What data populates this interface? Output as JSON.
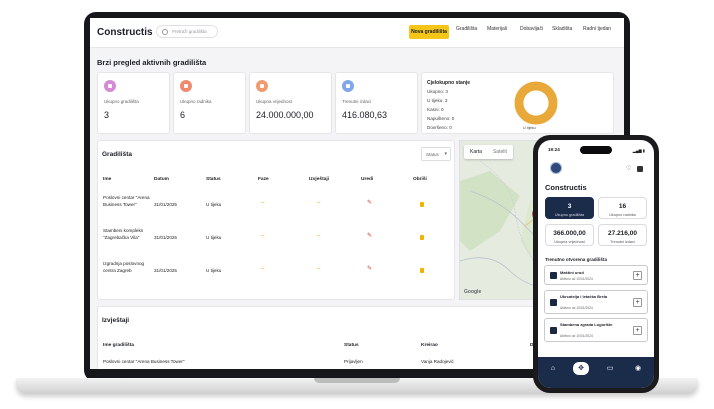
{
  "app": {
    "title": "Constructis",
    "search_placeholder": "Pretraži gradilišta"
  },
  "nav": {
    "items": [
      {
        "label": "Nova gradilišta",
        "active": true
      },
      {
        "label": "Gradilišta"
      },
      {
        "label": "Materijali"
      },
      {
        "label": "Dobavljači"
      },
      {
        "label": "Skladišta"
      },
      {
        "label": "Radni tjedan"
      }
    ]
  },
  "overview": {
    "title": "Brzi pregled aktivnih gradilišta",
    "stats": [
      {
        "label": "Ukupno gradilišta",
        "value": "3",
        "icon": "building-icon",
        "color": "#d68ad6"
      },
      {
        "label": "Ukupno radnika",
        "value": "6",
        "icon": "worker-icon",
        "color": "#f08a6e"
      },
      {
        "label": "Ukupna vrijednost",
        "value": "24.000.000,00",
        "icon": "money-icon",
        "color": "#f29a6f"
      },
      {
        "label": "Trenutni izdaci",
        "value": "416.080,63",
        "icon": "expense-icon",
        "color": "#7fa7ea"
      }
    ],
    "status_card": {
      "title": "Cjelokupno stanje",
      "lines": [
        "Ukupno: 3",
        "U tijeku: 3",
        "Kasni: 0",
        "Napušteno: 0",
        "Dovršeno: 0"
      ],
      "donut_label": "U tijeku",
      "donut_color": "#e9a93a"
    }
  },
  "sites": {
    "title": "Gradilišta",
    "filter": "Status",
    "columns": [
      "Ime",
      "Datum",
      "Status",
      "Faze",
      "Izvještaji",
      "Uredi",
      "Obriši"
    ],
    "rows": [
      {
        "name": "Poslovni centar \"Arena Business Tower\"",
        "date": "31/01/2025",
        "status": "U tijeku",
        "faze": "–",
        "izvjestaji": "–"
      },
      {
        "name": "Stambeni kompleks \"Zagrebačka Vila\"",
        "date": "31/01/2025",
        "status": "U tijeku",
        "faze": "–",
        "izvjestaji": "–"
      },
      {
        "name": "Izgradnja poslovnog centra Zagreb",
        "date": "31/01/2025",
        "status": "U tijeku",
        "faze": "–",
        "izvjestaji": "–"
      }
    ]
  },
  "map": {
    "tabs": [
      "Karta",
      "Satelit"
    ],
    "attribution": "Google"
  },
  "reports": {
    "title": "Izvještaji",
    "columns": [
      "Ime gradilišta",
      "Status",
      "Kreirao",
      "D"
    ],
    "rows": [
      {
        "site": "Poslovni centar \"Arena Business Tower\"",
        "status": "Prijavljen",
        "author": "Vanja Radojević"
      }
    ]
  },
  "phone": {
    "time": "19:24",
    "title": "Constructis",
    "cards": [
      {
        "value": "3",
        "label": "Ukupno gradilišta",
        "dark": true
      },
      {
        "value": "16",
        "label": "Ukupno radnika"
      },
      {
        "value": "366.000,00",
        "label": "Ukupna vrijednost"
      },
      {
        "value": "27.216,00",
        "label": "Trenutni izdaci"
      }
    ],
    "list_title": "Trenutno otvorena gradilišta",
    "list": [
      {
        "title": "Maštini urod",
        "date": "Aktivno od 10/01/2024"
      },
      {
        "title": "Ukrcatelja i letačka Brela",
        "date": "Aktivno od 10/01/2024"
      },
      {
        "title": "Stambena zgrada Logorište",
        "date": "Aktivno od 10/01/2024"
      }
    ]
  }
}
